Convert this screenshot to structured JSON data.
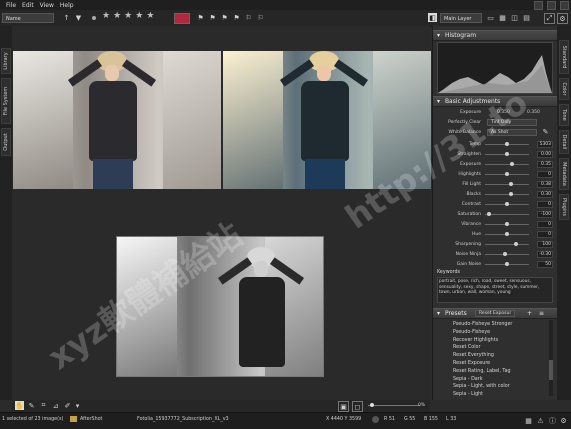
{
  "menu": [
    "File",
    "Edit",
    "View",
    "Help"
  ],
  "toolbar": {
    "sort_select": "Name",
    "layer_select": "Main Layer"
  },
  "left_tabs": [
    "Library",
    "File System",
    "Output"
  ],
  "right_tabs": [
    "Standard",
    "Color",
    "Tone",
    "Detail",
    "Metadata",
    "Plugins"
  ],
  "histogram": {
    "title": "Histogram"
  },
  "adjustments": {
    "title": "Basic Adjustments",
    "exposure_label": "Exposure",
    "exposure_val1": "0.350",
    "exposure_val2": "0.350",
    "perfectly_clear_label": "Perfectly Clear",
    "perfectly_clear_val": "Tint Only",
    "white_balance_label": "White Balance",
    "white_balance_val": "As Shot",
    "sliders": [
      {
        "label": "Temp",
        "value": "5303"
      },
      {
        "label": "Straighten",
        "value": "0.00"
      },
      {
        "label": "Exposure",
        "value": "0.35"
      },
      {
        "label": "Highlights",
        "value": "0"
      },
      {
        "label": "Fill Light",
        "value": "0.38"
      },
      {
        "label": "Blacks",
        "value": "0.30"
      },
      {
        "label": "Contrast",
        "value": "0"
      },
      {
        "label": "Saturation",
        "value": "-100"
      },
      {
        "label": "Vibrance",
        "value": "0"
      },
      {
        "label": "Hue",
        "value": "0"
      },
      {
        "label": "Sharpening",
        "value": "100"
      },
      {
        "label": "Noise Ninja",
        "value": "-0.30"
      },
      {
        "label": "Gain Noise",
        "value": "50"
      }
    ],
    "slider_positions": [
      0.5,
      0.5,
      0.62,
      0.5,
      0.6,
      0.58,
      0.5,
      0.1,
      0.5,
      0.5,
      0.7,
      0.45,
      0.5
    ]
  },
  "keywords": {
    "label": "Keywords",
    "text": "portrait, pose, rich, road, sweet, sensuous, sensuality, sexy, shape, street, style, summer, town, urban, wall, woman, young"
  },
  "presets": {
    "title": "Presets",
    "select": "Reset Exposur",
    "items": [
      "Pseudo-Fisheye Stronger",
      "Pseudo-Fisheye",
      "Recover Highlights",
      "Reset Color",
      "Reset Everything",
      "Reset Exposure",
      "Reset Rating, Label, Tag",
      "Sepia - Dark",
      "Sepia - Light, with color",
      "Sepia - Light"
    ]
  },
  "status": {
    "selection": "1 selected of 23 image(s)",
    "folder": "AfterShot",
    "filename": "Fotolia_15937772_Subscription_XL_v3",
    "coords": "X 4440 Y 3599",
    "zoom": "0%",
    "rgb": [
      "R 51",
      "G 55",
      "B 155",
      "L 33"
    ]
  },
  "watermark": [
    "http://31.to",
    "xyz軟體補給站"
  ]
}
